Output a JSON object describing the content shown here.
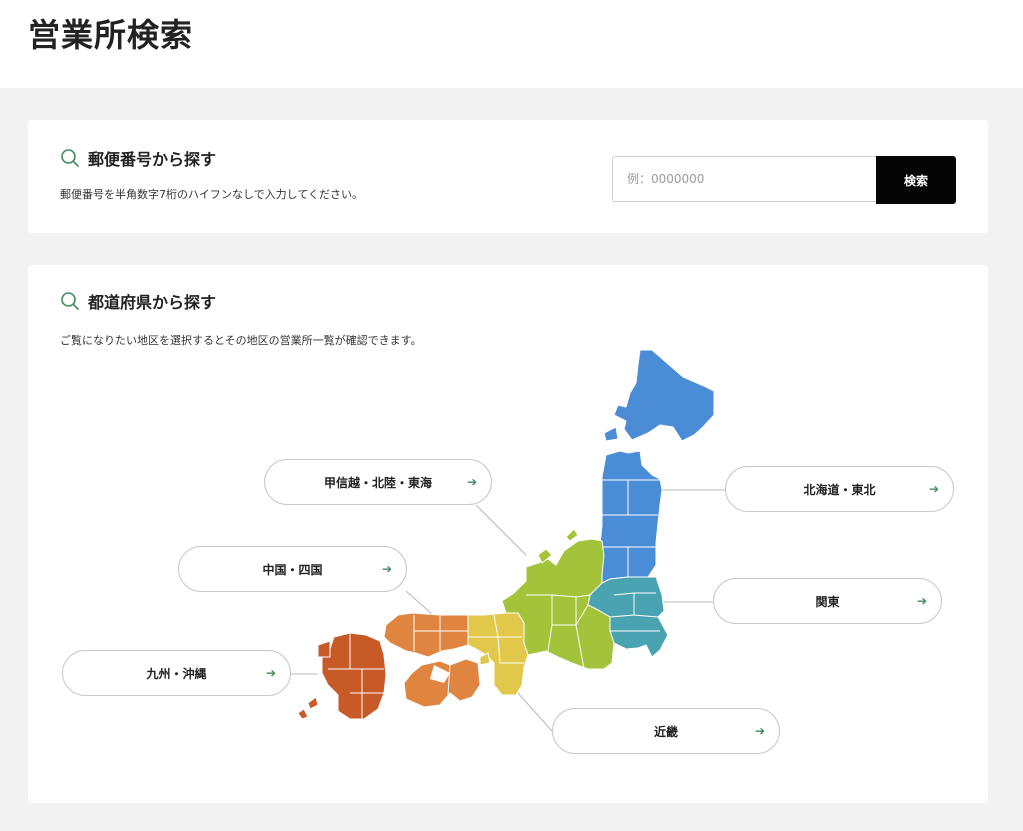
{
  "page": {
    "title": "営業所検索"
  },
  "zip_search": {
    "title": "郵便番号から探す",
    "description": "郵便番号を半角数字7桁のハイフンなしで入力してください。",
    "placeholder": "例：0000000",
    "button_label": "検索"
  },
  "pref_search": {
    "title": "都道府県から探す",
    "description": "ご覧になりたい地区を選択するとその地区の営業所一覧が確認できます。"
  },
  "regions": [
    {
      "id": "hokkaido-tohoku",
      "label": "北海道・東北",
      "color": "#4a8cd6"
    },
    {
      "id": "kanto",
      "label": "関東",
      "color": "#4aa3b0"
    },
    {
      "id": "koshinetsu-hokuriku-tokai",
      "label": "甲信越・北陸・東海",
      "color": "#a3c43a"
    },
    {
      "id": "kinki",
      "label": "近畿",
      "color": "#e2c84a"
    },
    {
      "id": "chugoku-shikoku",
      "label": "中国・四国",
      "color": "#e08540"
    },
    {
      "id": "kyushu-okinawa",
      "label": "九州・沖縄",
      "color": "#c85a28"
    }
  ],
  "icons": {
    "search": "search-icon",
    "arrow": "arrow-right-icon"
  },
  "arrow_glyph": "➔"
}
